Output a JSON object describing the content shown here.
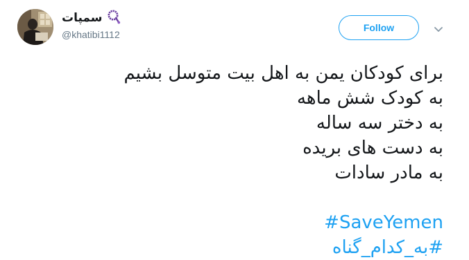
{
  "user": {
    "display_name": "سمپات",
    "handle": "@khatibi1112"
  },
  "follow_label": "Follow",
  "tweet_lines": [
    "برای کودکان یمن به اهل بیت متوسل بشیم",
    "به کودک شش ماهه",
    "به دختر سه ساله",
    "به دست های بریده",
    "به مادر سادات"
  ],
  "hashtags": [
    "#SaveYemen",
    "#به_کدام_گناه"
  ],
  "colors": {
    "accent": "#1da1f2",
    "text": "#14171a",
    "secondary": "#657786"
  },
  "icons": {
    "name_badge": "purple-prayer-beads-emoji",
    "menu": "chevron-down-icon"
  }
}
